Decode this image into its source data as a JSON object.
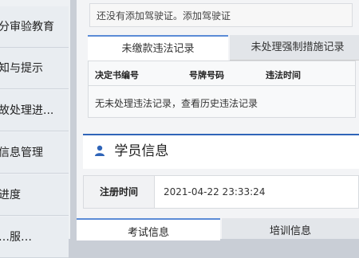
{
  "sidebar": {
    "items": [
      {
        "label": "分审验教育"
      },
      {
        "label": "知与提示"
      },
      {
        "label": "故处理进..."
      },
      {
        "label": "信息管理"
      },
      {
        "label": "进度"
      },
      {
        "label": "…服…"
      }
    ]
  },
  "license": {
    "text": "还没有添加驾驶证。添加驾驶证"
  },
  "violation_tabs": [
    {
      "label": "未缴款违法记录"
    },
    {
      "label": "未处理强制措施记录"
    }
  ],
  "violation_table": {
    "columns": [
      "决定书编号",
      "号牌号码",
      "违法时间"
    ],
    "empty_message": "无未处理违法记录，查看历史违法记录"
  },
  "student_section": {
    "title": "学员信息",
    "icon": "user-icon"
  },
  "registration": {
    "label": "注册时间",
    "value": "2021-04-22 23:33:24"
  },
  "bottom_tabs": [
    {
      "label": "考试信息"
    },
    {
      "label": "培训信息"
    }
  ]
}
